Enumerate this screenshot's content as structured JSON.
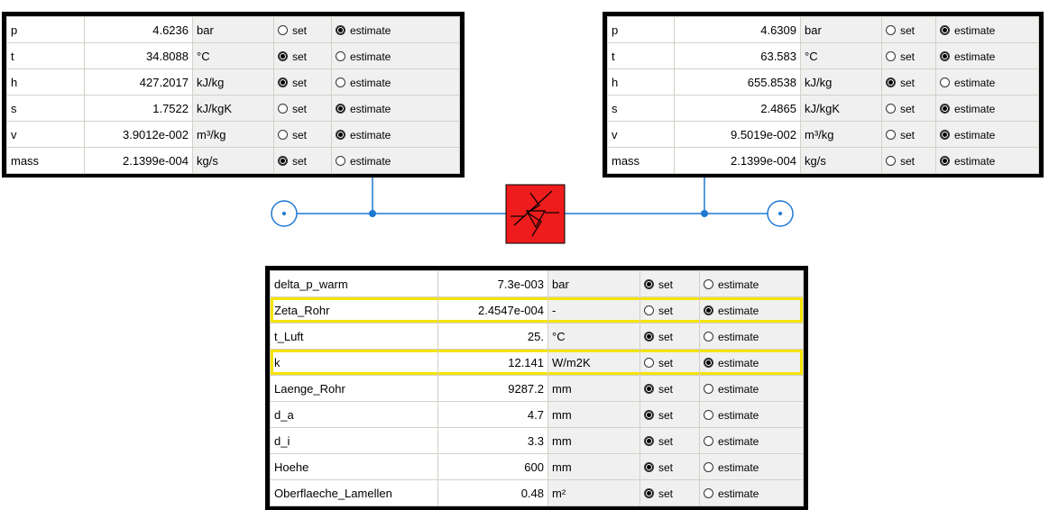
{
  "left_state": {
    "rows": [
      {
        "name": "p",
        "value": "4.6236",
        "unit": "bar",
        "mode": "estimate"
      },
      {
        "name": "t",
        "value": "34.8088",
        "unit": "°C",
        "mode": "set"
      },
      {
        "name": "h",
        "value": "427.2017",
        "unit": "kJ/kg",
        "mode": "set"
      },
      {
        "name": "s",
        "value": "1.7522",
        "unit": "kJ/kgK",
        "mode": "estimate"
      },
      {
        "name": "v",
        "value": "3.9012e-002",
        "unit": "m³/kg",
        "mode": "estimate"
      },
      {
        "name": "mass",
        "value": "2.1399e-004",
        "unit": "kg/s",
        "mode": "set"
      }
    ]
  },
  "right_state": {
    "rows": [
      {
        "name": "p",
        "value": "4.6309",
        "unit": "bar",
        "mode": "estimate"
      },
      {
        "name": "t",
        "value": "63.583",
        "unit": "°C",
        "mode": "estimate"
      },
      {
        "name": "h",
        "value": "655.8538",
        "unit": "kJ/kg",
        "mode": "set"
      },
      {
        "name": "s",
        "value": "2.4865",
        "unit": "kJ/kgK",
        "mode": "estimate"
      },
      {
        "name": "v",
        "value": "9.5019e-002",
        "unit": "m³/kg",
        "mode": "estimate"
      },
      {
        "name": "mass",
        "value": "2.1399e-004",
        "unit": "kg/s",
        "mode": "estimate"
      }
    ]
  },
  "component": {
    "rows": [
      {
        "name": "delta_p_warm",
        "value": "7.3e-003",
        "unit": "bar",
        "mode": "set"
      },
      {
        "name": "Zeta_Rohr",
        "value": "2.4547e-004",
        "unit": "-",
        "mode": "estimate",
        "highlight": true
      },
      {
        "name": "t_Luft",
        "value": "25.",
        "unit": "°C",
        "mode": "set"
      },
      {
        "name": "k",
        "value": "12.141",
        "unit": "W/m2K",
        "mode": "estimate",
        "highlight": true
      },
      {
        "name": "Laenge_Rohr",
        "value": "9287.2",
        "unit": "mm",
        "mode": "set"
      },
      {
        "name": "d_a",
        "value": "4.7",
        "unit": "mm",
        "mode": "set"
      },
      {
        "name": "d_i",
        "value": "3.3",
        "unit": "mm",
        "mode": "set"
      },
      {
        "name": "Hoehe",
        "value": "600",
        "unit": "mm",
        "mode": "set"
      },
      {
        "name": "Oberflaeche_Lamellen",
        "value": "0.48",
        "unit": "m²",
        "mode": "set"
      }
    ]
  },
  "labels": {
    "set": "set",
    "estimate": "estimate"
  },
  "colors": {
    "line": "#1e78d2",
    "component_fill": "#ee1c1c",
    "highlight": "#f5e400"
  },
  "icons": {
    "component": "heat-exchanger-icon",
    "node": "port-circle-icon"
  }
}
